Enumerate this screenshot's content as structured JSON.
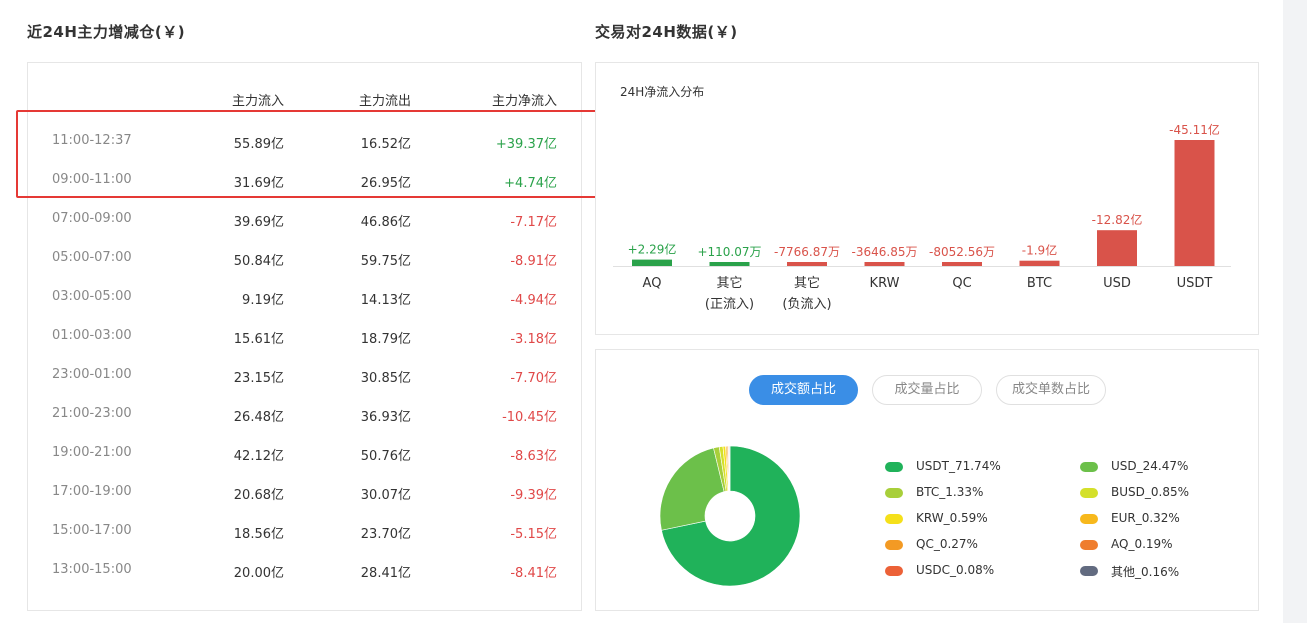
{
  "left_title": "近24H主力增减仓(￥)",
  "right_title": "交易对24H数据(￥)",
  "table": {
    "headers": [
      "",
      "主力流入",
      "主力流出",
      "主力净流入"
    ],
    "rows": [
      {
        "time": "11:00-12:37",
        "inflow": "55.89亿",
        "outflow": "16.52亿",
        "net": "+39.37亿",
        "sign": "pos"
      },
      {
        "time": "09:00-11:00",
        "inflow": "31.69亿",
        "outflow": "26.95亿",
        "net": "+4.74亿",
        "sign": "pos"
      },
      {
        "time": "07:00-09:00",
        "inflow": "39.69亿",
        "outflow": "46.86亿",
        "net": "-7.17亿",
        "sign": "neg"
      },
      {
        "time": "05:00-07:00",
        "inflow": "50.84亿",
        "outflow": "59.75亿",
        "net": "-8.91亿",
        "sign": "neg"
      },
      {
        "time": "03:00-05:00",
        "inflow": "9.19亿",
        "outflow": "14.13亿",
        "net": "-4.94亿",
        "sign": "neg"
      },
      {
        "time": "01:00-03:00",
        "inflow": "15.61亿",
        "outflow": "18.79亿",
        "net": "-3.18亿",
        "sign": "neg"
      },
      {
        "time": "23:00-01:00",
        "inflow": "23.15亿",
        "outflow": "30.85亿",
        "net": "-7.70亿",
        "sign": "neg"
      },
      {
        "time": "21:00-23:00",
        "inflow": "26.48亿",
        "outflow": "36.93亿",
        "net": "-10.45亿",
        "sign": "neg"
      },
      {
        "time": "19:00-21:00",
        "inflow": "42.12亿",
        "outflow": "50.76亿",
        "net": "-8.63亿",
        "sign": "neg"
      },
      {
        "time": "17:00-19:00",
        "inflow": "20.68亿",
        "outflow": "30.07亿",
        "net": "-9.39亿",
        "sign": "neg"
      },
      {
        "time": "15:00-17:00",
        "inflow": "18.56亿",
        "outflow": "23.70亿",
        "net": "-5.15亿",
        "sign": "neg"
      },
      {
        "time": "13:00-15:00",
        "inflow": "20.00亿",
        "outflow": "28.41亿",
        "net": "-8.41亿",
        "sign": "neg"
      }
    ]
  },
  "dist_chart": {
    "title": "24H净流入分布",
    "chart_data": {
      "type": "bar",
      "categories": [
        [
          "AQ"
        ],
        [
          "其它",
          "(正流入)"
        ],
        [
          "其它",
          "(负流入)"
        ],
        [
          "KRW"
        ],
        [
          "QC"
        ],
        [
          "BTC"
        ],
        [
          "USD"
        ],
        [
          "USDT"
        ]
      ],
      "labels": [
        "+2.29亿",
        "+110.07万",
        "-7766.87万",
        "-3646.85万",
        "-8052.56万",
        "-1.9亿",
        "-12.82亿",
        "-45.11亿"
      ],
      "values": [
        2.29,
        0.011,
        -0.777,
        -0.365,
        -0.805,
        -1.9,
        -12.82,
        -45.11
      ],
      "unit": "亿",
      "colors": {
        "positive": "#2aa24a",
        "negative": "#d9534a"
      }
    }
  },
  "ratio": {
    "tabs": [
      "成交额占比",
      "成交量占比",
      "成交单数占比"
    ],
    "active_tab": 0,
    "chart_data": {
      "type": "pie",
      "slices": [
        {
          "label": "USDT_71.74%",
          "value": 71.74,
          "color": "#20b25a"
        },
        {
          "label": "USD_24.47%",
          "value": 24.47,
          "color": "#6cc04a"
        },
        {
          "label": "BTC_1.33%",
          "value": 1.33,
          "color": "#a8cf3a"
        },
        {
          "label": "BUSD_0.85%",
          "value": 0.85,
          "color": "#d4e02a"
        },
        {
          "label": "KRW_0.59%",
          "value": 0.59,
          "color": "#f5e01a"
        },
        {
          "label": "EUR_0.32%",
          "value": 0.32,
          "color": "#f7b81c"
        },
        {
          "label": "QC_0.27%",
          "value": 0.27,
          "color": "#f39a24"
        },
        {
          "label": "AQ_0.19%",
          "value": 0.19,
          "color": "#ef7d2e"
        },
        {
          "label": "USDC_0.08%",
          "value": 0.08,
          "color": "#ec6137"
        },
        {
          "label": "其他_0.16%",
          "value": 0.16,
          "color": "#626b80"
        }
      ]
    }
  }
}
